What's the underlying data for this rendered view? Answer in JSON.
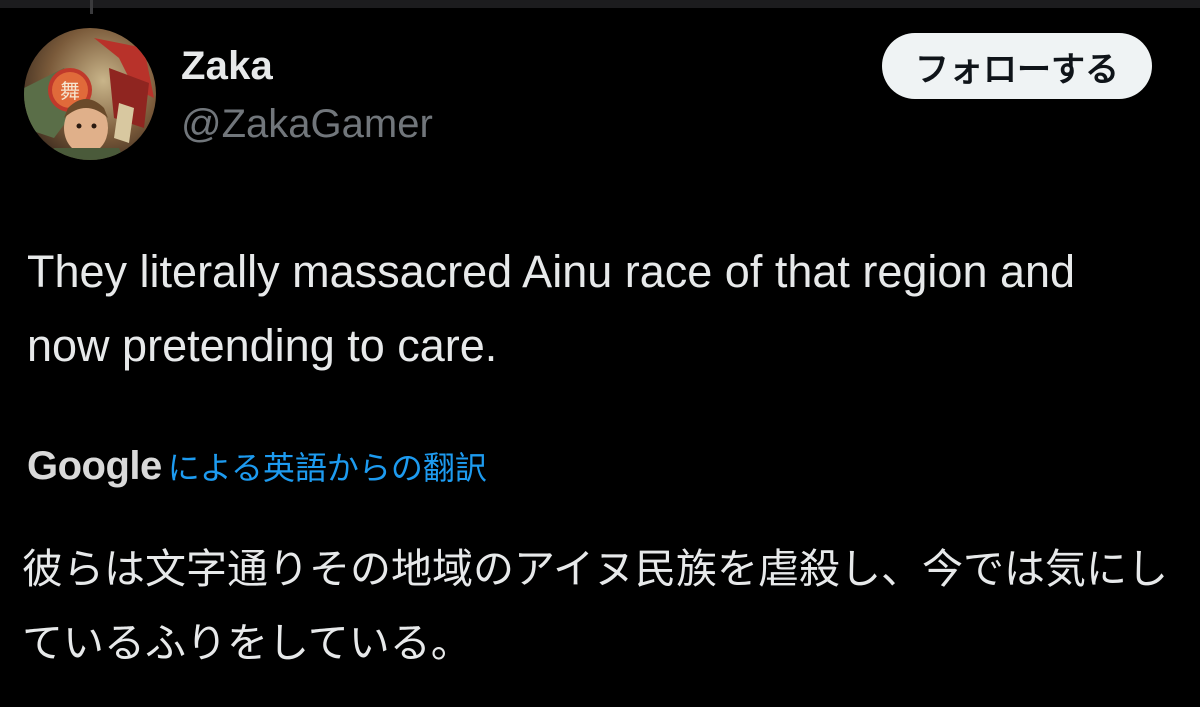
{
  "user": {
    "display_name": "Zaka",
    "handle": "@ZakaGamer"
  },
  "follow_button": {
    "label": "フォローする"
  },
  "tweet": {
    "text": "They literally massacred Ainu race of that region and now pretending to care."
  },
  "translation": {
    "provider": "Google",
    "label": "による英語からの翻訳",
    "text": "彼らは文字通りその地域のアイヌ民族を虐殺し、今では気にしているふりをしている。"
  },
  "colors": {
    "background": "#000000",
    "primary_text": "#e7e9ea",
    "secondary_text": "#71767b",
    "link": "#1d9bf0",
    "button_bg": "#eff3f4"
  }
}
